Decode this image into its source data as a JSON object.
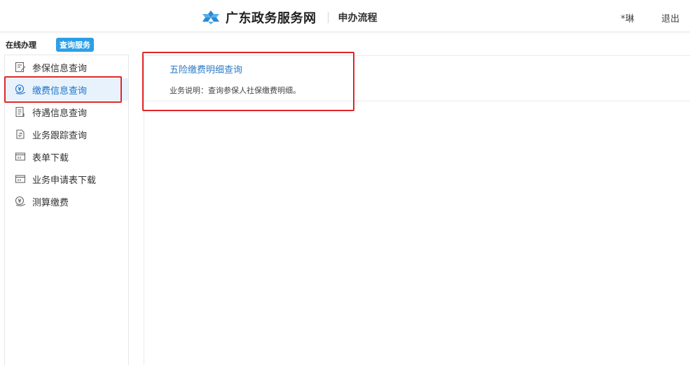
{
  "header": {
    "site_name": "广东政务服务网",
    "section_title": "申办流程",
    "user_name": "*琳",
    "logout_label": "退出",
    "brand_color": "#2b8ad8"
  },
  "subnav": {
    "online_label": "在线办理",
    "query_tab_label": "查询服务"
  },
  "sidebar": {
    "items": [
      {
        "label": "参保信息查询",
        "icon": "edit-doc-icon",
        "active": false
      },
      {
        "label": "缴费信息查询",
        "icon": "payment-icon",
        "active": true
      },
      {
        "label": "待遇信息查询",
        "icon": "doc-list-icon",
        "active": false
      },
      {
        "label": "业务跟踪查询",
        "icon": "tracking-icon",
        "active": false
      },
      {
        "label": "表单下载",
        "icon": "form-icon",
        "active": false
      },
      {
        "label": "业务申请表下载",
        "icon": "form-icon",
        "active": false
      },
      {
        "label": "测算缴费",
        "icon": "payment-icon",
        "active": false
      }
    ]
  },
  "content": {
    "service_title": "五险缴费明细查询",
    "service_desc": "业务说明：查询参保人社保缴费明细。"
  },
  "colors": {
    "highlight": "#e0262a",
    "active_bg": "#e8f2fc",
    "link": "#2b7cc7"
  }
}
